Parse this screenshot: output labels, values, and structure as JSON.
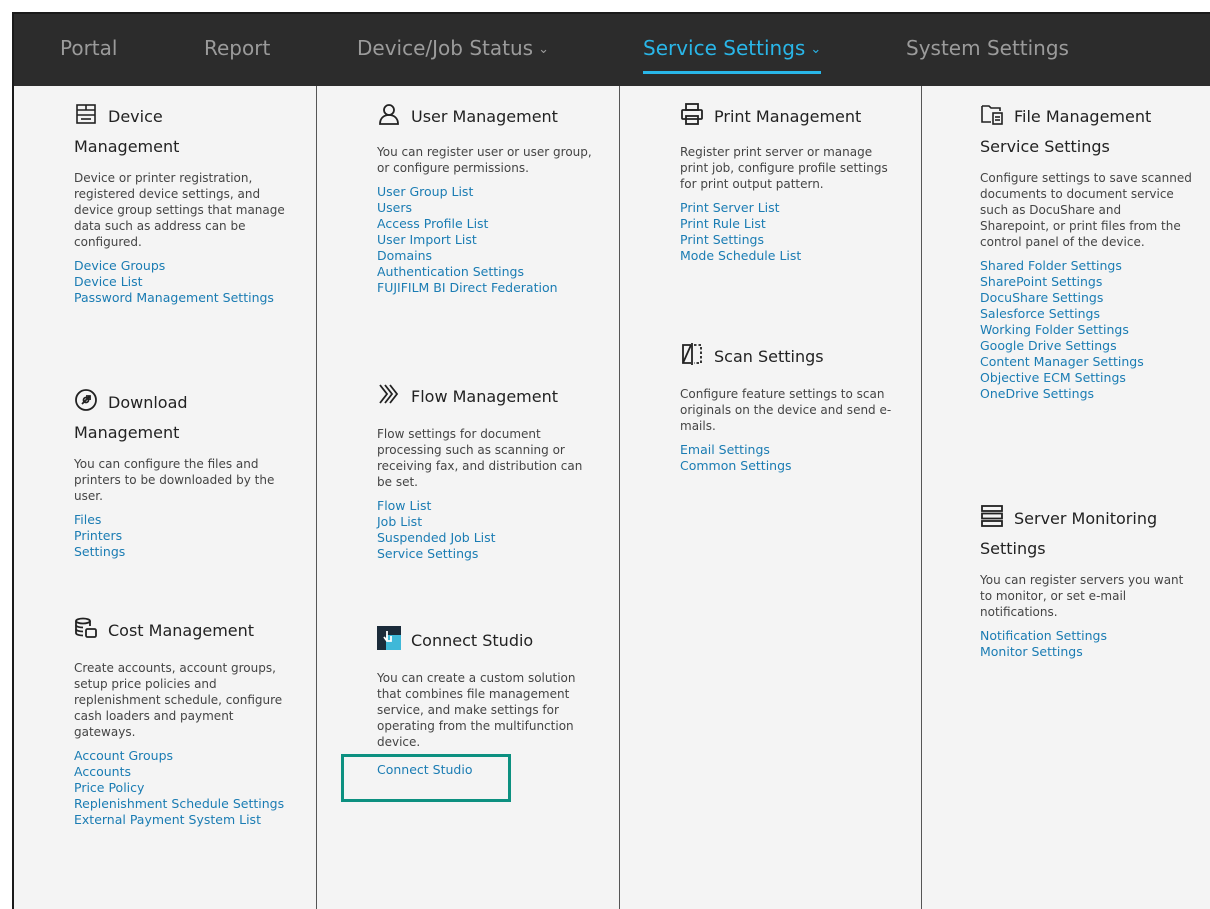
{
  "nav": {
    "portal": "Portal",
    "report": "Report",
    "device_job_status": "Device/Job Status",
    "service_settings": "Service Settings",
    "system_settings": "System Settings"
  },
  "colors": {
    "accent": "#29b6e8",
    "nav_bg": "#2c2c2c",
    "link": "#1a7cb3",
    "highlight": "#0c9080"
  },
  "col1": {
    "device": {
      "title1": "Device",
      "title2": "Management",
      "desc": "Device or printer registration, registered device settings, and device group settings that manage data such as address can be configured.",
      "links": [
        "Device Groups",
        "Device List",
        "Password Management Settings"
      ]
    },
    "download": {
      "title1": "Download",
      "title2": "Management",
      "desc": "You can configure the files and printers to be downloaded by the user.",
      "links": [
        "Files",
        "Printers",
        "Settings"
      ]
    },
    "cost": {
      "title1": "Cost Management",
      "desc": "Create accounts, account groups, setup price policies and replenishment schedule, configure cash loaders and payment gateways.",
      "links": [
        "Account Groups",
        "Accounts",
        "Price Policy",
        "Replenishment Schedule Settings",
        "External Payment System List"
      ]
    }
  },
  "col2": {
    "user": {
      "title1": "User Management",
      "desc": "You can register user or user group, or configure permissions.",
      "links": [
        "User Group List",
        "Users",
        "Access Profile List",
        "User Import List",
        "Domains",
        "Authentication Settings",
        "FUJIFILM BI Direct Federation"
      ]
    },
    "flow": {
      "title1": "Flow Management",
      "desc": "Flow settings for document processing such as scanning or receiving fax, and distribution can be set.",
      "links": [
        "Flow List",
        "Job List",
        "Suspended Job List",
        "Service Settings"
      ]
    },
    "connect": {
      "title1": "Connect Studio",
      "desc": "You can create a custom solution that combines file management service, and make settings for operating from the multifunction device.",
      "links": [
        "Connect Studio"
      ]
    }
  },
  "col3": {
    "print": {
      "title1": "Print Management",
      "desc": "Register print server or manage print job, configure profile settings for print output pattern.",
      "links": [
        "Print Server List",
        "Print Rule List",
        "Print Settings",
        "Mode Schedule List"
      ]
    },
    "scan": {
      "title1": "Scan Settings",
      "desc": "Configure feature settings to scan originals on the device and send e-mails.",
      "links": [
        "Email Settings",
        "Common Settings"
      ]
    }
  },
  "col4": {
    "file": {
      "title1": "File Management",
      "title2": "Service Settings",
      "desc": "Configure settings to save scanned documents to document service such as DocuShare and Sharepoint, or print files from the control panel of the device.",
      "links": [
        "Shared Folder Settings",
        "SharePoint Settings",
        "DocuShare Settings",
        "Salesforce Settings",
        "Working Folder Settings",
        "Google Drive Settings",
        "Content Manager Settings",
        "Objective ECM Settings",
        "OneDrive Settings"
      ]
    },
    "server": {
      "title1": "Server Monitoring",
      "title2": "Settings",
      "desc": "You can register servers you want to monitor, or set e-mail notifications.",
      "links": [
        "Notification Settings",
        "Monitor Settings"
      ]
    }
  }
}
